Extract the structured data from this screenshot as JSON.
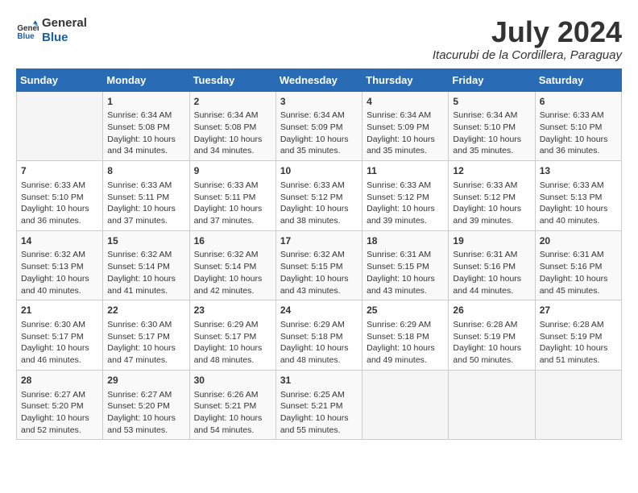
{
  "logo": {
    "text_general": "General",
    "text_blue": "Blue"
  },
  "title": "July 2024",
  "location": "Itacurubi de la Cordillera, Paraguay",
  "header_days": [
    "Sunday",
    "Monday",
    "Tuesday",
    "Wednesday",
    "Thursday",
    "Friday",
    "Saturday"
  ],
  "weeks": [
    [
      {
        "day": "",
        "info": ""
      },
      {
        "day": "1",
        "info": "Sunrise: 6:34 AM\nSunset: 5:08 PM\nDaylight: 10 hours\nand 34 minutes."
      },
      {
        "day": "2",
        "info": "Sunrise: 6:34 AM\nSunset: 5:08 PM\nDaylight: 10 hours\nand 34 minutes."
      },
      {
        "day": "3",
        "info": "Sunrise: 6:34 AM\nSunset: 5:09 PM\nDaylight: 10 hours\nand 35 minutes."
      },
      {
        "day": "4",
        "info": "Sunrise: 6:34 AM\nSunset: 5:09 PM\nDaylight: 10 hours\nand 35 minutes."
      },
      {
        "day": "5",
        "info": "Sunrise: 6:34 AM\nSunset: 5:10 PM\nDaylight: 10 hours\nand 35 minutes."
      },
      {
        "day": "6",
        "info": "Sunrise: 6:33 AM\nSunset: 5:10 PM\nDaylight: 10 hours\nand 36 minutes."
      }
    ],
    [
      {
        "day": "7",
        "info": "Sunrise: 6:33 AM\nSunset: 5:10 PM\nDaylight: 10 hours\nand 36 minutes."
      },
      {
        "day": "8",
        "info": "Sunrise: 6:33 AM\nSunset: 5:11 PM\nDaylight: 10 hours\nand 37 minutes."
      },
      {
        "day": "9",
        "info": "Sunrise: 6:33 AM\nSunset: 5:11 PM\nDaylight: 10 hours\nand 37 minutes."
      },
      {
        "day": "10",
        "info": "Sunrise: 6:33 AM\nSunset: 5:12 PM\nDaylight: 10 hours\nand 38 minutes."
      },
      {
        "day": "11",
        "info": "Sunrise: 6:33 AM\nSunset: 5:12 PM\nDaylight: 10 hours\nand 39 minutes."
      },
      {
        "day": "12",
        "info": "Sunrise: 6:33 AM\nSunset: 5:12 PM\nDaylight: 10 hours\nand 39 minutes."
      },
      {
        "day": "13",
        "info": "Sunrise: 6:33 AM\nSunset: 5:13 PM\nDaylight: 10 hours\nand 40 minutes."
      }
    ],
    [
      {
        "day": "14",
        "info": "Sunrise: 6:32 AM\nSunset: 5:13 PM\nDaylight: 10 hours\nand 40 minutes."
      },
      {
        "day": "15",
        "info": "Sunrise: 6:32 AM\nSunset: 5:14 PM\nDaylight: 10 hours\nand 41 minutes."
      },
      {
        "day": "16",
        "info": "Sunrise: 6:32 AM\nSunset: 5:14 PM\nDaylight: 10 hours\nand 42 minutes."
      },
      {
        "day": "17",
        "info": "Sunrise: 6:32 AM\nSunset: 5:15 PM\nDaylight: 10 hours\nand 43 minutes."
      },
      {
        "day": "18",
        "info": "Sunrise: 6:31 AM\nSunset: 5:15 PM\nDaylight: 10 hours\nand 43 minutes."
      },
      {
        "day": "19",
        "info": "Sunrise: 6:31 AM\nSunset: 5:16 PM\nDaylight: 10 hours\nand 44 minutes."
      },
      {
        "day": "20",
        "info": "Sunrise: 6:31 AM\nSunset: 5:16 PM\nDaylight: 10 hours\nand 45 minutes."
      }
    ],
    [
      {
        "day": "21",
        "info": "Sunrise: 6:30 AM\nSunset: 5:17 PM\nDaylight: 10 hours\nand 46 minutes."
      },
      {
        "day": "22",
        "info": "Sunrise: 6:30 AM\nSunset: 5:17 PM\nDaylight: 10 hours\nand 47 minutes."
      },
      {
        "day": "23",
        "info": "Sunrise: 6:29 AM\nSunset: 5:17 PM\nDaylight: 10 hours\nand 48 minutes."
      },
      {
        "day": "24",
        "info": "Sunrise: 6:29 AM\nSunset: 5:18 PM\nDaylight: 10 hours\nand 48 minutes."
      },
      {
        "day": "25",
        "info": "Sunrise: 6:29 AM\nSunset: 5:18 PM\nDaylight: 10 hours\nand 49 minutes."
      },
      {
        "day": "26",
        "info": "Sunrise: 6:28 AM\nSunset: 5:19 PM\nDaylight: 10 hours\nand 50 minutes."
      },
      {
        "day": "27",
        "info": "Sunrise: 6:28 AM\nSunset: 5:19 PM\nDaylight: 10 hours\nand 51 minutes."
      }
    ],
    [
      {
        "day": "28",
        "info": "Sunrise: 6:27 AM\nSunset: 5:20 PM\nDaylight: 10 hours\nand 52 minutes."
      },
      {
        "day": "29",
        "info": "Sunrise: 6:27 AM\nSunset: 5:20 PM\nDaylight: 10 hours\nand 53 minutes."
      },
      {
        "day": "30",
        "info": "Sunrise: 6:26 AM\nSunset: 5:21 PM\nDaylight: 10 hours\nand 54 minutes."
      },
      {
        "day": "31",
        "info": "Sunrise: 6:25 AM\nSunset: 5:21 PM\nDaylight: 10 hours\nand 55 minutes."
      },
      {
        "day": "",
        "info": ""
      },
      {
        "day": "",
        "info": ""
      },
      {
        "day": "",
        "info": ""
      }
    ]
  ]
}
